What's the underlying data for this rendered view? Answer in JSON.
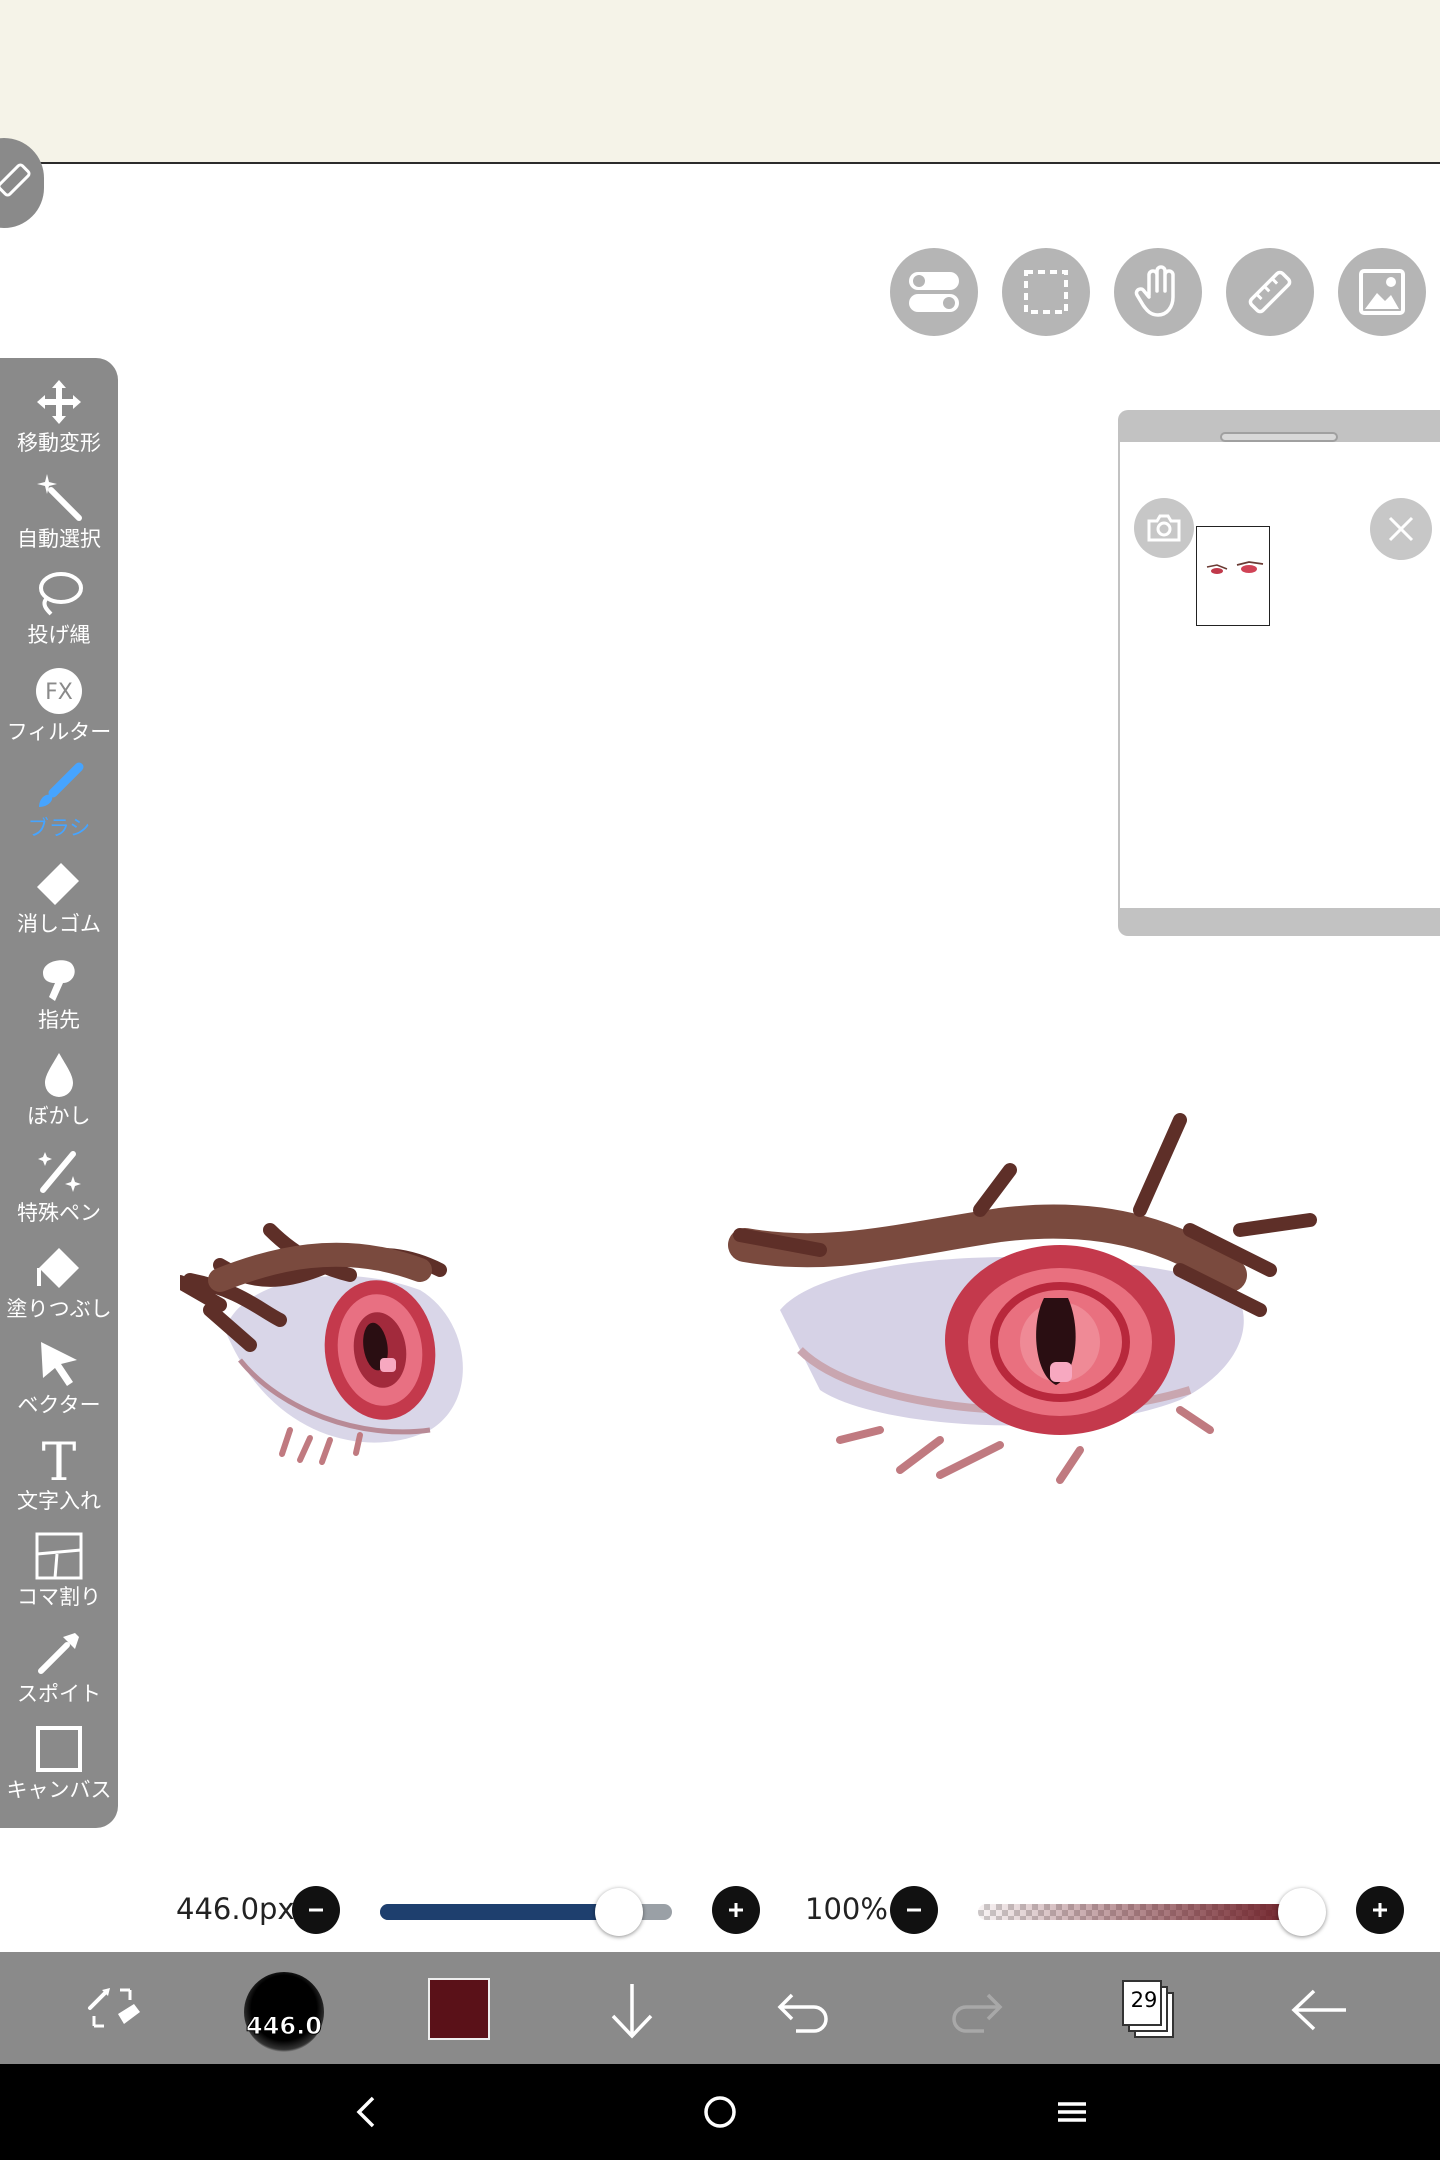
{
  "toolbar": {
    "tools": [
      {
        "id": "move",
        "label": "移動変形",
        "icon": "move-icon"
      },
      {
        "id": "magic-wand",
        "label": "自動選択",
        "icon": "magic-wand-icon"
      },
      {
        "id": "lasso",
        "label": "投げ縄",
        "icon": "lasso-icon"
      },
      {
        "id": "filter",
        "label": "フィルター",
        "icon": "fx-icon",
        "icon_text": "FX"
      },
      {
        "id": "brush",
        "label": "ブラシ",
        "icon": "brush-icon",
        "active": true
      },
      {
        "id": "eraser",
        "label": "消しゴム",
        "icon": "eraser-icon"
      },
      {
        "id": "smudge",
        "label": "指先",
        "icon": "finger-icon"
      },
      {
        "id": "blur",
        "label": "ぼかし",
        "icon": "droplet-icon"
      },
      {
        "id": "special-pen",
        "label": "特殊ペン",
        "icon": "sparkle-pen-icon"
      },
      {
        "id": "fill",
        "label": "塗りつぶし",
        "icon": "fill-icon"
      },
      {
        "id": "vector",
        "label": "ベクター",
        "icon": "cursor-icon"
      },
      {
        "id": "text",
        "label": "文字入れ",
        "icon": "text-icon",
        "icon_text": "T"
      },
      {
        "id": "frame",
        "label": "コマ割り",
        "icon": "frame-divider-icon"
      },
      {
        "id": "eyedropper",
        "label": "スポイト",
        "icon": "eyedropper-icon"
      },
      {
        "id": "canvas",
        "label": "キャンバス",
        "icon": "canvas-icon"
      }
    ]
  },
  "top_buttons": [
    "toggle-icon",
    "selection-icon",
    "hand-icon",
    "ruler-icon",
    "image-icon"
  ],
  "navigator": {
    "camera_icon": "camera-icon",
    "close_icon": "close-icon"
  },
  "brush_size": {
    "value_label": "446.0px",
    "level": 0.82
  },
  "opacity": {
    "value_label": "100%",
    "level": 1.0
  },
  "bottom_bar": {
    "brush_preview_label": "446.0",
    "color": "#5a1118",
    "layer_count": "29"
  },
  "colors": {
    "toolbar_bg": "#8a8a8a",
    "active_tool": "#46a4ff",
    "top_bar_bg": "#f5f3e8",
    "slider_fill": "#1e3f6e"
  }
}
